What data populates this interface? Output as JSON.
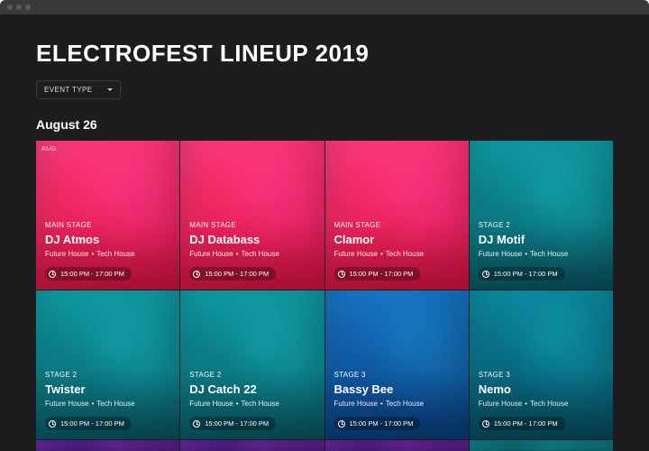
{
  "header": {
    "title": "ELECTROFEST LINEUP 2019",
    "filter_label": "EVENT TYPE"
  },
  "date_heading": "August 26",
  "month_badge": "AUG",
  "cards": [
    {
      "stage": "MAIN STAGE",
      "artist": "DJ Atmos",
      "genre1": "Future House",
      "genre2": "Tech House",
      "time": "15:00 PM - 17:00 PM",
      "color": "pink"
    },
    {
      "stage": "MAIN STAGE",
      "artist": "DJ Databass",
      "genre1": "Future House",
      "genre2": "Tech House",
      "time": "15:00 PM - 17:00 PM",
      "color": "pink"
    },
    {
      "stage": "MAIN STAGE",
      "artist": "Clamor",
      "genre1": "Future House",
      "genre2": "Tech House",
      "time": "15:00 PM - 17:00 PM",
      "color": "pink"
    },
    {
      "stage": "STAGE 2",
      "artist": "DJ Motif",
      "genre1": "Future House",
      "genre2": "Tech House",
      "time": "15:00 PM - 17:00 PM",
      "color": "teal"
    },
    {
      "stage": "STAGE 2",
      "artist": "Twister",
      "genre1": "Future House",
      "genre2": "Tech House",
      "time": "15:00 PM - 17:00 PM",
      "color": "teal"
    },
    {
      "stage": "STAGE 2",
      "artist": "DJ Catch 22",
      "genre1": "Future House",
      "genre2": "Tech House",
      "time": "15:00 PM - 17:00 PM",
      "color": "teal"
    },
    {
      "stage": "STAGE 3",
      "artist": "Bassy Bee",
      "genre1": "Future House",
      "genre2": "Tech House",
      "time": "15:00 PM - 17:00 PM",
      "color": "blue"
    },
    {
      "stage": "STAGE 3",
      "artist": "Nemo",
      "genre1": "Future House",
      "genre2": "Tech House",
      "time": "15:00 PM - 17:00 PM",
      "color": "tealblue"
    }
  ],
  "stub_colors": [
    "purple",
    "purple",
    "purple",
    "teal"
  ]
}
